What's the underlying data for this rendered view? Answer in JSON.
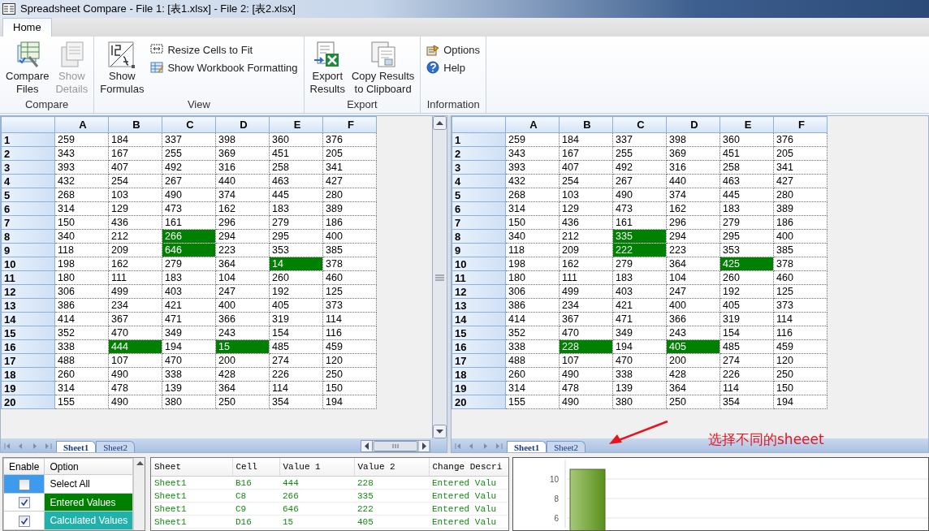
{
  "window": {
    "title": "Spreadsheet Compare - File 1: [表1.xlsx] - File 2: [表2.xlsx]"
  },
  "ribbon_tabs": [
    {
      "label": "Home",
      "selected": true
    }
  ],
  "ribbon": {
    "groups": [
      {
        "label": "Compare",
        "buttons": [
          {
            "label": "Compare\nFiles",
            "kind": "large",
            "disabled": false
          },
          {
            "label": "Show\nDetails",
            "kind": "large",
            "disabled": true
          }
        ]
      },
      {
        "label": "View",
        "buttons": [
          {
            "label": "Show\nFormulas",
            "kind": "large",
            "disabled": false
          },
          {
            "label": "Resize Cells to Fit",
            "kind": "small",
            "disabled": false
          },
          {
            "label": "Show Workbook Formatting",
            "kind": "small",
            "disabled": false
          }
        ]
      },
      {
        "label": "Export",
        "buttons": [
          {
            "label": "Export\nResults",
            "kind": "large",
            "disabled": false
          },
          {
            "label": "Copy Results\nto Clipboard",
            "kind": "large",
            "disabled": false
          }
        ]
      },
      {
        "label": "Information",
        "buttons": [
          {
            "label": "Options",
            "kind": "small",
            "disabled": false
          },
          {
            "label": "Help",
            "kind": "small",
            "disabled": false
          }
        ]
      }
    ]
  },
  "panes": [
    {
      "columns": [
        "A",
        "B",
        "C",
        "D",
        "E",
        "F"
      ],
      "rows": [
        {
          "label": "1",
          "cells": [
            "259",
            "184",
            "337",
            "398",
            "360",
            "376"
          ]
        },
        {
          "label": "2",
          "cells": [
            "343",
            "167",
            "255",
            "369",
            "451",
            "205"
          ]
        },
        {
          "label": "3",
          "cells": [
            "393",
            "407",
            "492",
            "316",
            "258",
            "341"
          ]
        },
        {
          "label": "4",
          "cells": [
            "432",
            "254",
            "267",
            "440",
            "463",
            "427"
          ]
        },
        {
          "label": "5",
          "cells": [
            "268",
            "103",
            "490",
            "374",
            "445",
            "280"
          ]
        },
        {
          "label": "6",
          "cells": [
            "314",
            "129",
            "473",
            "162",
            "183",
            "389"
          ]
        },
        {
          "label": "7",
          "cells": [
            "150",
            "436",
            "161",
            "296",
            "279",
            "186"
          ]
        },
        {
          "label": "8",
          "cells": [
            "340",
            "212",
            {
              "value": "266",
              "changed": true
            },
            "294",
            "295",
            "400"
          ]
        },
        {
          "label": "9",
          "cells": [
            "118",
            "209",
            {
              "value": "646",
              "changed": true
            },
            "223",
            "353",
            "385"
          ]
        },
        {
          "label": "10",
          "cells": [
            "198",
            "162",
            "279",
            "364",
            {
              "value": "14",
              "changed": true
            },
            "378"
          ]
        },
        {
          "label": "11",
          "cells": [
            "180",
            "111",
            "183",
            "104",
            "260",
            "460"
          ]
        },
        {
          "label": "12",
          "cells": [
            "306",
            "499",
            "403",
            "247",
            "192",
            "125"
          ]
        },
        {
          "label": "13",
          "cells": [
            "386",
            "234",
            "421",
            "400",
            "405",
            "373"
          ]
        },
        {
          "label": "14",
          "cells": [
            "414",
            "367",
            "471",
            "366",
            "319",
            "114"
          ]
        },
        {
          "label": "15",
          "cells": [
            "352",
            "470",
            "349",
            "243",
            "154",
            "116"
          ]
        },
        {
          "label": "16",
          "cells": [
            "338",
            {
              "value": "444",
              "changed": true
            },
            "194",
            {
              "value": "15",
              "changed": true
            },
            "485",
            "459"
          ]
        },
        {
          "label": "17",
          "cells": [
            "488",
            "107",
            "470",
            "200",
            "274",
            "120"
          ]
        },
        {
          "label": "18",
          "cells": [
            "260",
            "490",
            "338",
            "428",
            "226",
            "250"
          ]
        },
        {
          "label": "19",
          "cells": [
            "314",
            "478",
            "139",
            "364",
            "114",
            "150"
          ]
        },
        {
          "label": "20",
          "cells": [
            "155",
            "490",
            "380",
            "250",
            "354",
            "194"
          ]
        }
      ],
      "sheet_tabs": [
        {
          "label": "Sheet1",
          "selected": true
        },
        {
          "label": "Sheet2",
          "selected": false
        }
      ]
    },
    {
      "columns": [
        "A",
        "B",
        "C",
        "D",
        "E",
        "F"
      ],
      "rows": [
        {
          "label": "1",
          "cells": [
            "259",
            "184",
            "337",
            "398",
            "360",
            "376"
          ]
        },
        {
          "label": "2",
          "cells": [
            "343",
            "167",
            "255",
            "369",
            "451",
            "205"
          ]
        },
        {
          "label": "3",
          "cells": [
            "393",
            "407",
            "492",
            "316",
            "258",
            "341"
          ]
        },
        {
          "label": "4",
          "cells": [
            "432",
            "254",
            "267",
            "440",
            "463",
            "427"
          ]
        },
        {
          "label": "5",
          "cells": [
            "268",
            "103",
            "490",
            "374",
            "445",
            "280"
          ]
        },
        {
          "label": "6",
          "cells": [
            "314",
            "129",
            "473",
            "162",
            "183",
            "389"
          ]
        },
        {
          "label": "7",
          "cells": [
            "150",
            "436",
            "161",
            "296",
            "279",
            "186"
          ]
        },
        {
          "label": "8",
          "cells": [
            "340",
            "212",
            {
              "value": "335",
              "changed": true
            },
            "294",
            "295",
            "400"
          ]
        },
        {
          "label": "9",
          "cells": [
            "118",
            "209",
            {
              "value": "222",
              "changed": true
            },
            "223",
            "353",
            "385"
          ]
        },
        {
          "label": "10",
          "cells": [
            "198",
            "162",
            "279",
            "364",
            {
              "value": "425",
              "changed": true
            },
            "378"
          ]
        },
        {
          "label": "11",
          "cells": [
            "180",
            "111",
            "183",
            "104",
            "260",
            "460"
          ]
        },
        {
          "label": "12",
          "cells": [
            "306",
            "499",
            "403",
            "247",
            "192",
            "125"
          ]
        },
        {
          "label": "13",
          "cells": [
            "386",
            "234",
            "421",
            "400",
            "405",
            "373"
          ]
        },
        {
          "label": "14",
          "cells": [
            "414",
            "367",
            "471",
            "366",
            "319",
            "114"
          ]
        },
        {
          "label": "15",
          "cells": [
            "352",
            "470",
            "349",
            "243",
            "154",
            "116"
          ]
        },
        {
          "label": "16",
          "cells": [
            "338",
            {
              "value": "228",
              "changed": true
            },
            "194",
            {
              "value": "405",
              "changed": true
            },
            "485",
            "459"
          ]
        },
        {
          "label": "17",
          "cells": [
            "488",
            "107",
            "470",
            "200",
            "274",
            "120"
          ]
        },
        {
          "label": "18",
          "cells": [
            "260",
            "490",
            "338",
            "428",
            "226",
            "250"
          ]
        },
        {
          "label": "19",
          "cells": [
            "314",
            "478",
            "139",
            "364",
            "114",
            "150"
          ]
        },
        {
          "label": "20",
          "cells": [
            "155",
            "490",
            "380",
            "250",
            "354",
            "194"
          ]
        }
      ],
      "sheet_tabs": [
        {
          "label": "Sheet1",
          "selected": true
        },
        {
          "label": "Sheet2",
          "selected": false
        }
      ]
    }
  ],
  "annotation": {
    "text": "选择不同的sheeet"
  },
  "options": {
    "columns": [
      "Enable",
      "Option"
    ],
    "items": [
      {
        "label": "Select All",
        "checked": false,
        "selected": true
      },
      {
        "label": "Entered Values",
        "checked": true,
        "selected": false,
        "color": "#008000"
      },
      {
        "label": "Calculated Values",
        "checked": true,
        "selected": false,
        "color": "#20b2aa"
      }
    ]
  },
  "results": {
    "columns": [
      "Sheet",
      "Cell",
      "Value 1",
      "Value 2",
      "Change Descri"
    ],
    "rows": [
      [
        "Sheet1",
        "B16",
        "444",
        "228",
        "Entered Valu"
      ],
      [
        "Sheet1",
        "C8",
        "266",
        "335",
        "Entered Valu"
      ],
      [
        "Sheet1",
        "C9",
        "646",
        "222",
        "Entered Valu"
      ],
      [
        "Sheet1",
        "D16",
        "15",
        "405",
        "Entered Valu"
      ]
    ]
  },
  "chart": {
    "chart_data": {
      "type": "bar",
      "values": [
        11
      ],
      "ylim": [
        5,
        12
      ],
      "yticks": [
        6,
        8,
        10
      ],
      "grid": true
    }
  }
}
